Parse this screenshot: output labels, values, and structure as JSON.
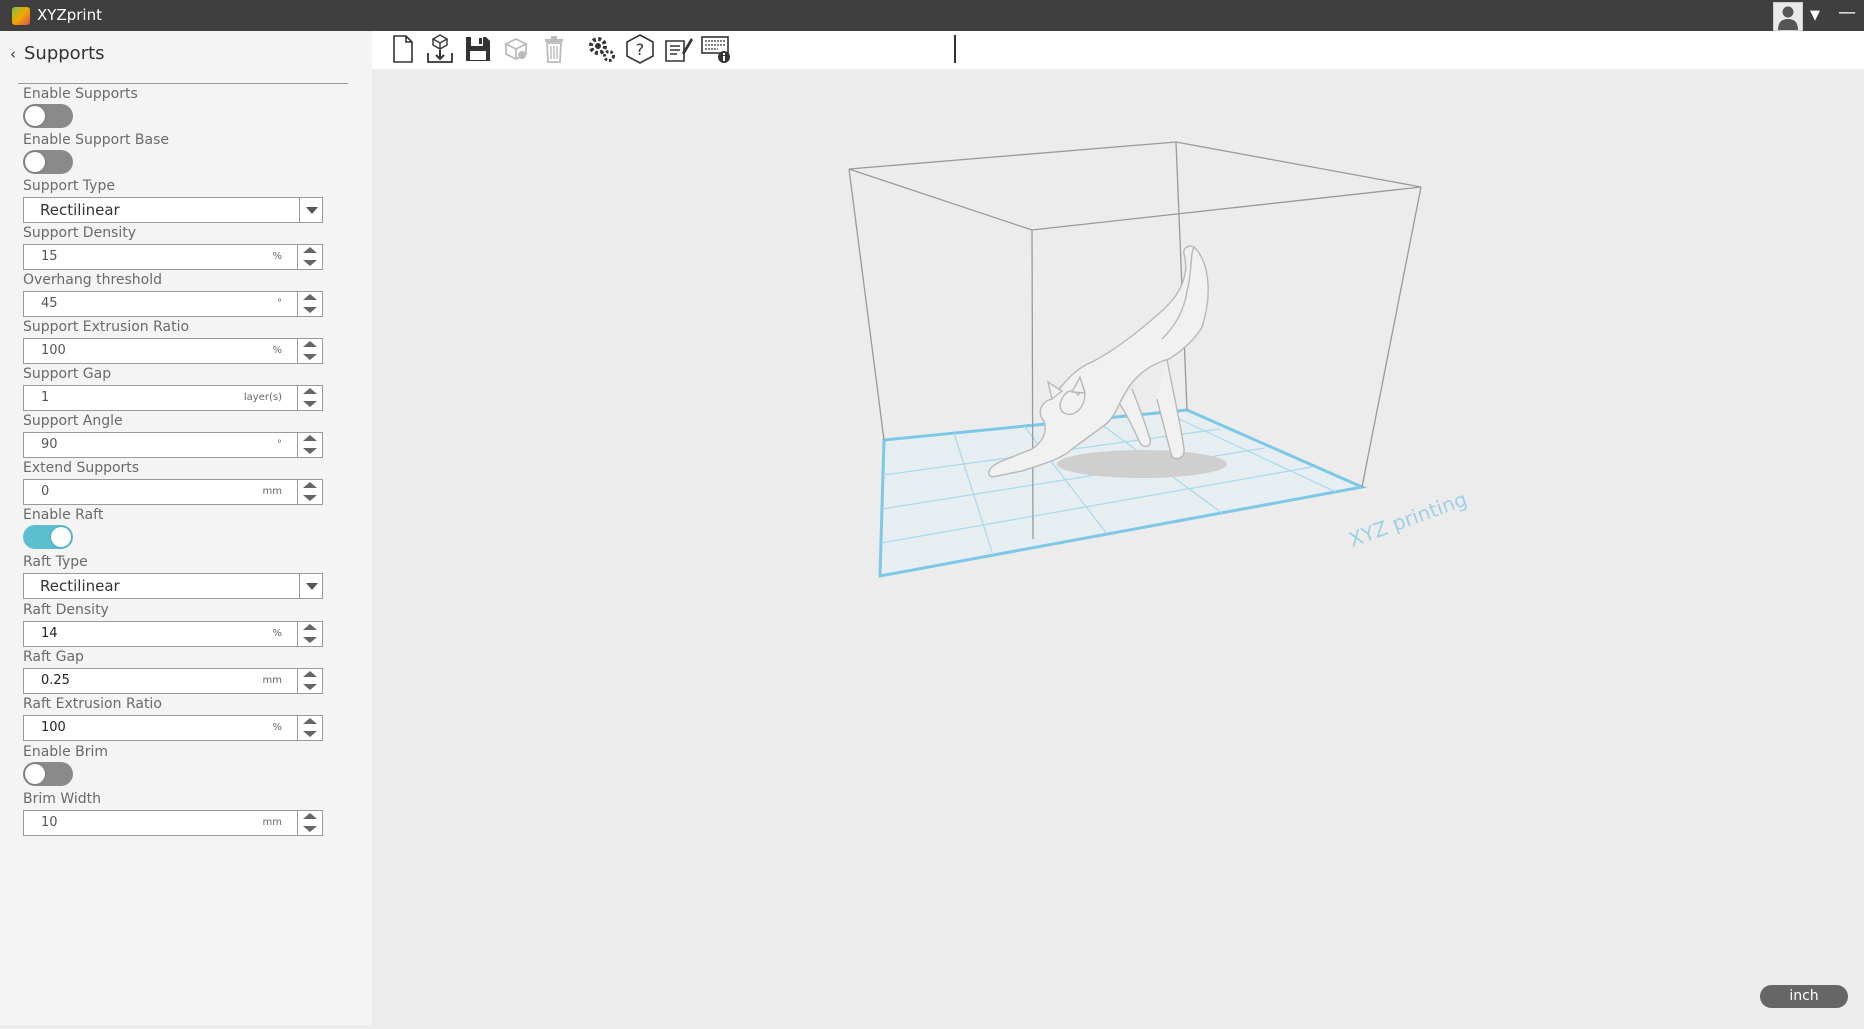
{
  "app": {
    "title": "XYZprint"
  },
  "panel": {
    "title": "Supports",
    "enable_supports": {
      "label": "Enable Supports",
      "on": false
    },
    "enable_support_base": {
      "label": "Enable Support Base",
      "on": false
    },
    "support_type": {
      "label": "Support Type",
      "value": "Rectilinear"
    },
    "support_density": {
      "label": "Support Density",
      "value": "15",
      "unit": "%"
    },
    "overhang_threshold": {
      "label": "Overhang threshold",
      "value": "45",
      "unit": "°"
    },
    "support_extrusion_ratio": {
      "label": "Support Extrusion Ratio",
      "value": "100",
      "unit": "%"
    },
    "support_gap": {
      "label": "Support Gap",
      "value": "1",
      "unit": "layer(s)"
    },
    "support_angle": {
      "label": "Support Angle",
      "value": "90",
      "unit": "°"
    },
    "extend_supports": {
      "label": "Extend Supports",
      "value": "0",
      "unit": "mm"
    },
    "enable_raft": {
      "label": "Enable Raft",
      "on": true
    },
    "raft_type": {
      "label": "Raft Type",
      "value": "Rectilinear"
    },
    "raft_density": {
      "label": "Raft Density",
      "value": "14",
      "unit": "%"
    },
    "raft_gap": {
      "label": "Raft Gap",
      "value": "0.25",
      "unit": "mm"
    },
    "raft_extrusion_ratio": {
      "label": "Raft Extrusion Ratio",
      "value": "100",
      "unit": "%"
    },
    "enable_brim": {
      "label": "Enable Brim",
      "on": false
    },
    "brim_width": {
      "label": "Brim Width",
      "value": "10",
      "unit": "mm"
    }
  },
  "toolbar": {
    "icons": [
      "new-file-icon",
      "import-icon",
      "save-icon",
      "model-icon",
      "delete-icon",
      "settings-icon",
      "help-icon",
      "notes-icon",
      "printer-info-icon"
    ]
  },
  "viewport": {
    "bed_label": "XYZ printing",
    "unit_button": "inch"
  },
  "colors": {
    "accent": "#5bbfd0",
    "bed_grid": "#7cc8e6"
  }
}
